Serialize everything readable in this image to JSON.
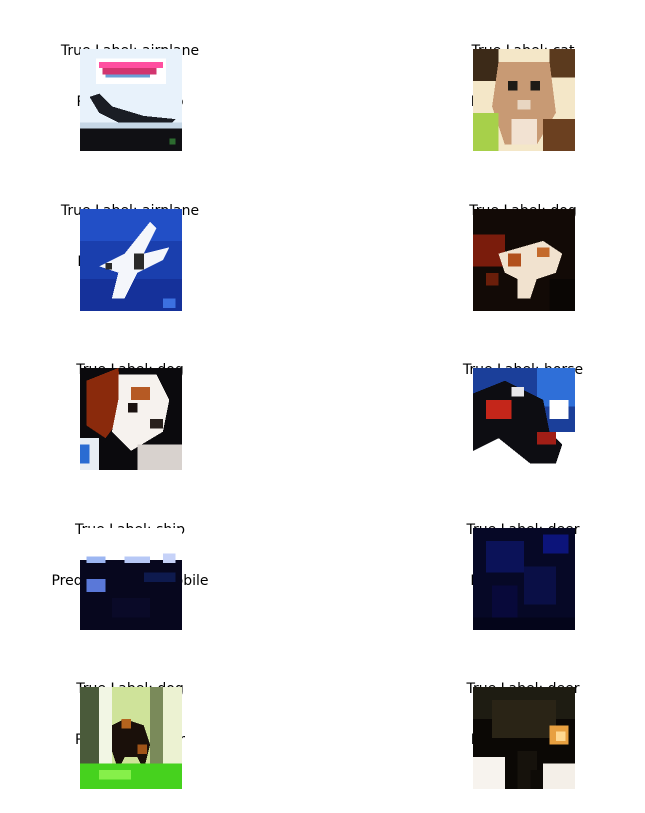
{
  "panels": [
    {
      "true_text": "True Label: airplane",
      "pred_text": "Pred Label:ship",
      "image": "airplane-over-sign-photo"
    },
    {
      "true_text": "True Label: cat",
      "pred_text": "Pred Label:dog",
      "image": "cat-closeup-photo"
    },
    {
      "true_text": "True Label: airplane",
      "pred_text": "Pred Label:bird",
      "image": "jet-blue-sky-photo"
    },
    {
      "true_text": "True Label: dog",
      "pred_text": "Pred Label:cat",
      "image": "dog-dark-background-photo"
    },
    {
      "true_text": "True Label: dog",
      "pred_text": "Pred Label:cat",
      "image": "beagle-face-photo"
    },
    {
      "true_text": "True Label: horse",
      "pred_text": "Pred Label:cat",
      "image": "horse-head-photo"
    },
    {
      "true_text": "True Label: ship",
      "pred_text": "Pred Label:automobile",
      "image": "ship-dark-photo"
    },
    {
      "true_text": "True Label: deer",
      "pred_text": "Pred Label:bird",
      "image": "deer-dark-blue-photo"
    },
    {
      "true_text": "True Label: dog",
      "pred_text": "Pred Label:deer",
      "image": "dog-grass-photo"
    },
    {
      "true_text": "True Label: deer",
      "pred_text": "Pred Label:dog",
      "image": "deer-dark-legs-photo"
    }
  ]
}
